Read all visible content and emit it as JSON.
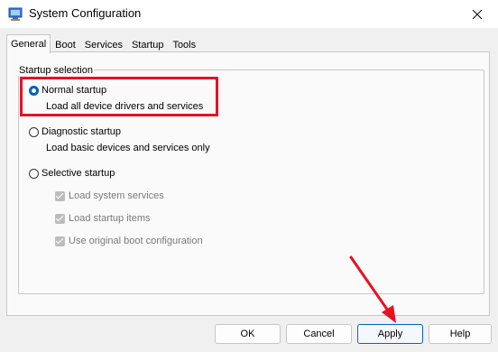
{
  "window": {
    "title": "System Configuration"
  },
  "tabs": [
    {
      "label": "General",
      "active": true
    },
    {
      "label": "Boot"
    },
    {
      "label": "Services"
    },
    {
      "label": "Startup"
    },
    {
      "label": "Tools"
    }
  ],
  "startup_selection": {
    "group_label": "Startup selection",
    "normal": {
      "label": "Normal startup",
      "desc": "Load all device drivers and services",
      "selected": true
    },
    "diagnostic": {
      "label": "Diagnostic startup",
      "desc": "Load basic devices and services only",
      "selected": false
    },
    "selective": {
      "label": "Selective startup",
      "selected": false,
      "options": [
        {
          "label": "Load system services",
          "checked": true,
          "enabled": false
        },
        {
          "label": "Load startup items",
          "checked": true,
          "enabled": false
        },
        {
          "label": "Use original boot configuration",
          "checked": true,
          "enabled": false
        }
      ]
    }
  },
  "buttons": {
    "ok": "OK",
    "cancel": "Cancel",
    "apply": "Apply",
    "help": "Help"
  },
  "annotation": {
    "highlight_color": "#e81123",
    "arrow_color": "#e81123"
  },
  "colors": {
    "accent": "#0060c0"
  }
}
